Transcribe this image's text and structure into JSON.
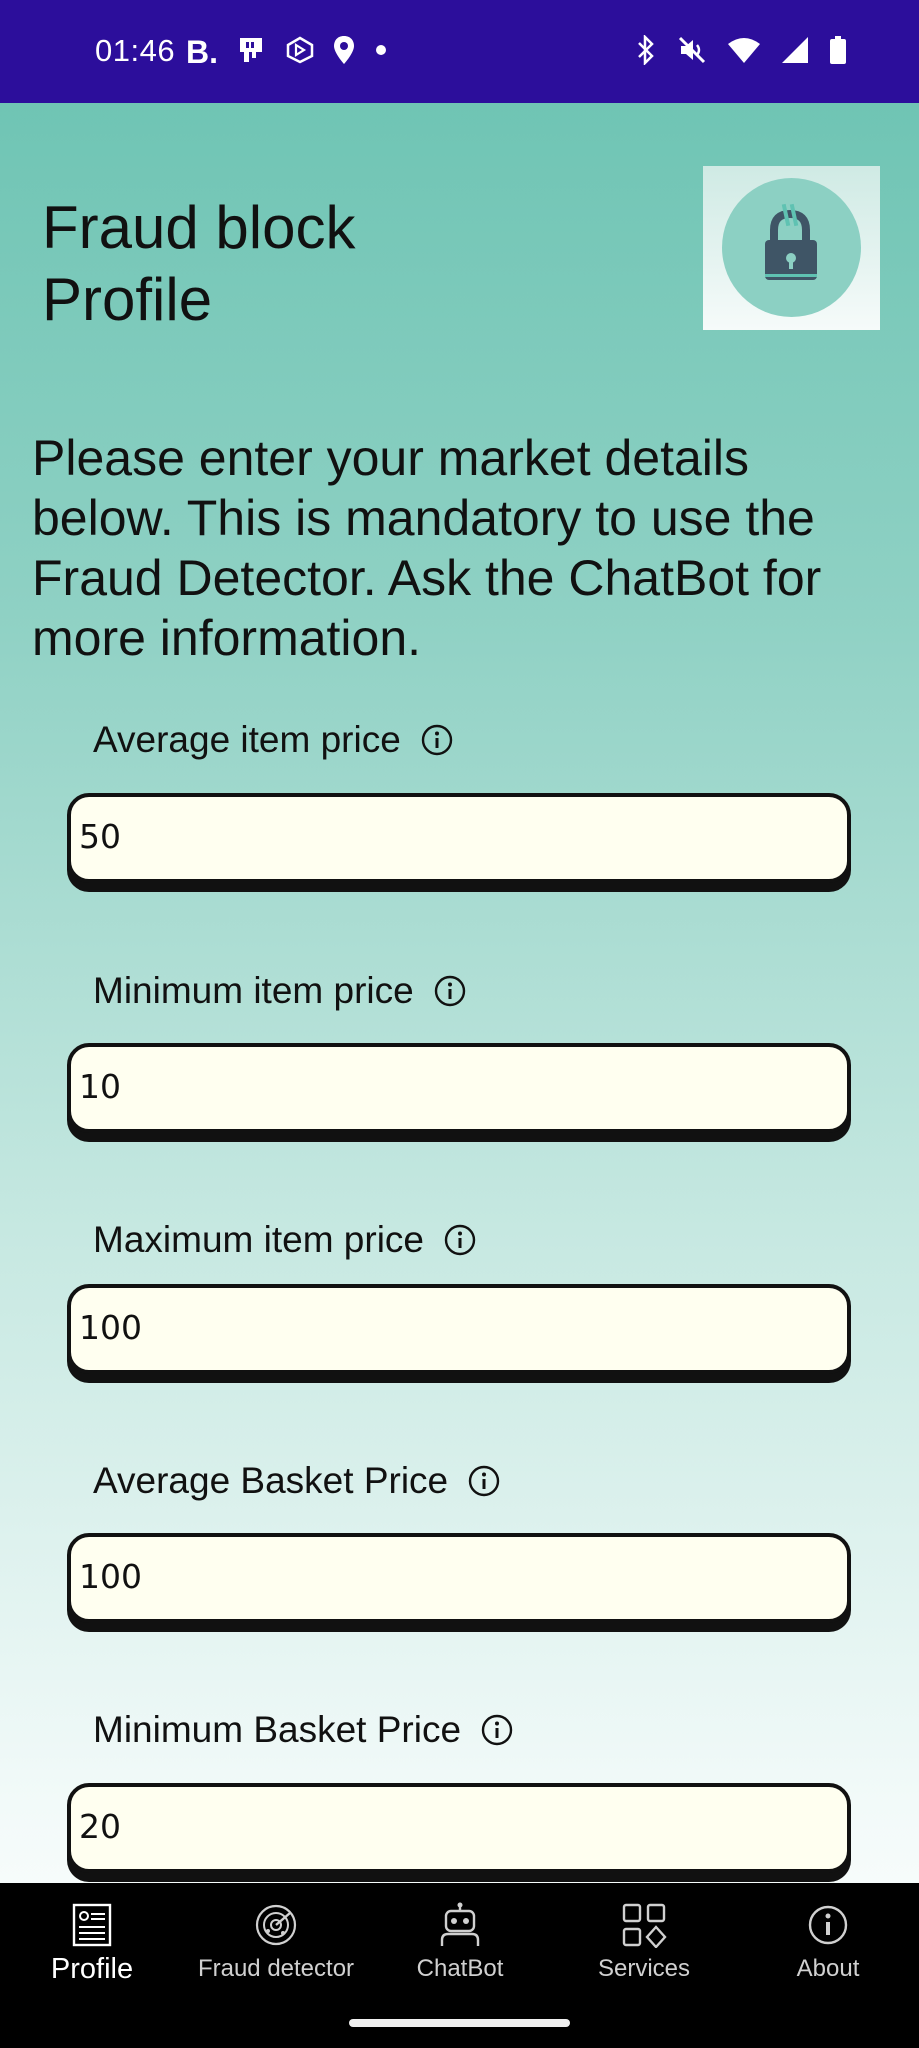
{
  "status_bar": {
    "time": "01:46",
    "app_badge": "B.",
    "left_icons": [
      "sim-card-icon",
      "pentagon-app-icon",
      "location-pin-icon",
      "dot-icon"
    ],
    "right_icons": [
      "bluetooth-icon",
      "vibrate-off-icon",
      "wifi-icon",
      "signal-icon",
      "battery-icon"
    ],
    "background": "#2c0e9b"
  },
  "header": {
    "title_line1": "Fraud block",
    "title_line2": "Profile",
    "logo_icon": "lock-icon"
  },
  "intro": {
    "text": "Please enter your market details below. This is mandatory to use the Fraud Detector. Ask the ChatBot for more information."
  },
  "form": {
    "fields": [
      {
        "label": "Average item price",
        "value": "50"
      },
      {
        "label": "Minimum item price",
        "value": "10"
      },
      {
        "label": "Maximum item price",
        "value": "100"
      },
      {
        "label": "Average Basket Price",
        "value": "100"
      },
      {
        "label": "Minimum Basket Price",
        "value": "20"
      }
    ]
  },
  "bottom_nav": {
    "items": [
      {
        "label": "Profile",
        "icon": "profile-card-icon",
        "active": true
      },
      {
        "label": "Fraud detector",
        "icon": "radar-icon",
        "active": false
      },
      {
        "label": "ChatBot",
        "icon": "robot-icon",
        "active": false
      },
      {
        "label": "Services",
        "icon": "grid-icon",
        "active": false
      },
      {
        "label": "About",
        "icon": "info-icon",
        "active": false
      }
    ]
  },
  "colors": {
    "accent_teal": "#69c2b1",
    "input_background": "#fffff0",
    "nav_background": "#000000"
  }
}
